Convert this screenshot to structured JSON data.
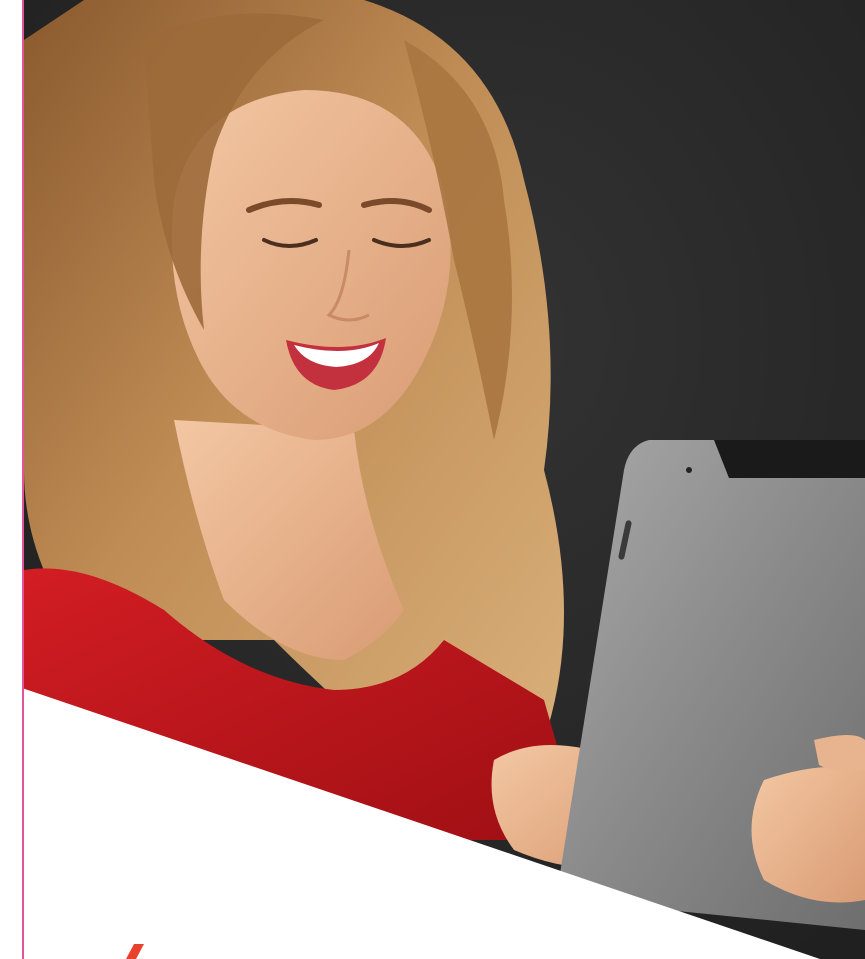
{
  "image": {
    "subject": "smiling-woman-holding-tablet-icon",
    "colors": {
      "background": "#262626",
      "accent_line": "#e0559a",
      "shirt": "#c8161d",
      "hair": "#b7844c",
      "skin": "#e8b48f",
      "tablet": "#8c8c8c",
      "mark": "#e8412d"
    }
  }
}
